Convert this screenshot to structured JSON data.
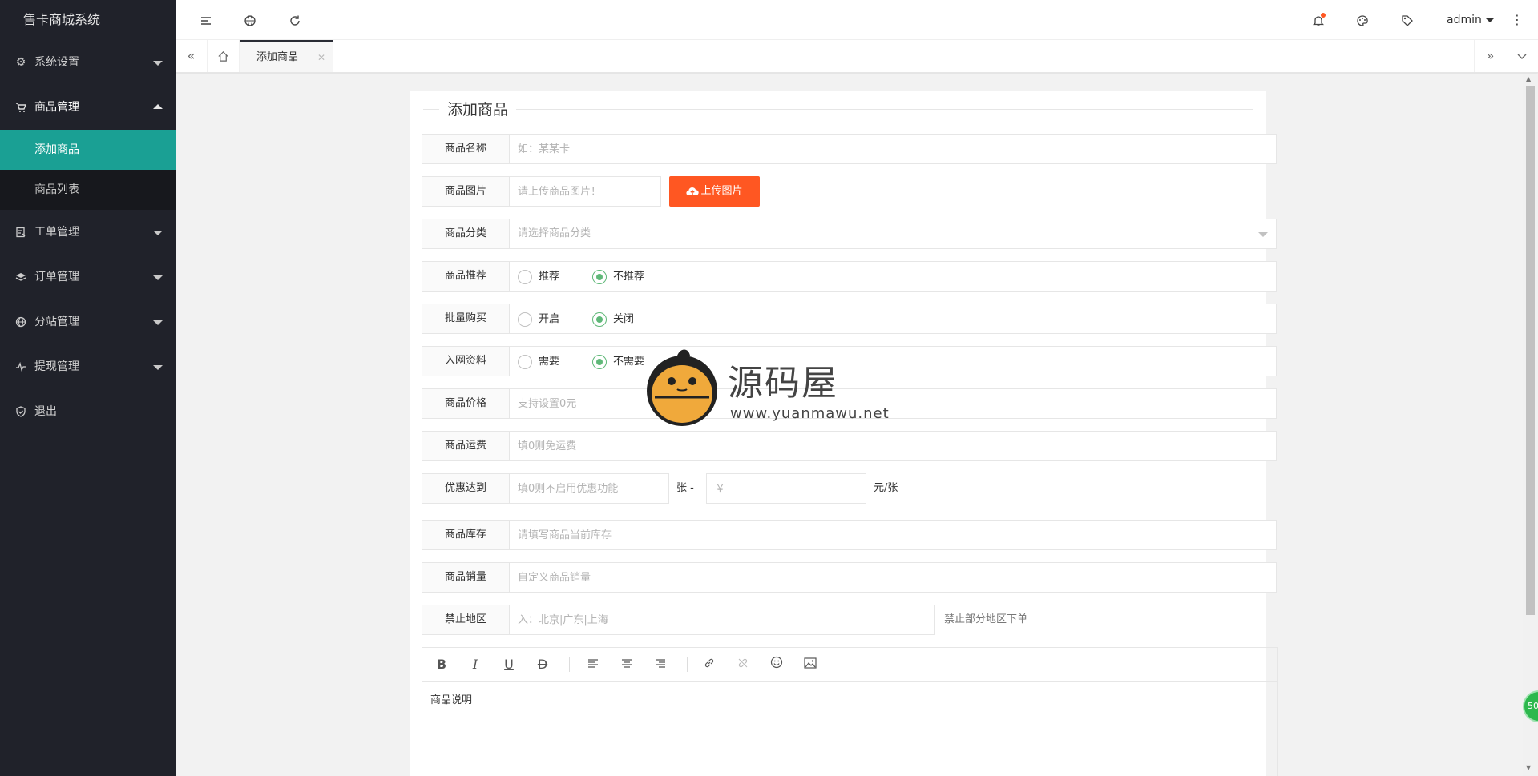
{
  "app": {
    "title": "售卡商城系统"
  },
  "sidebar": {
    "items": [
      {
        "label": "系统设置",
        "icon": "gear-icon",
        "open": false
      },
      {
        "label": "商品管理",
        "icon": "cart-icon",
        "open": true,
        "children": [
          {
            "label": "添加商品",
            "active": true
          },
          {
            "label": "商品列表",
            "active": false
          }
        ]
      },
      {
        "label": "工单管理",
        "icon": "ticket-icon",
        "open": false
      },
      {
        "label": "订单管理",
        "icon": "layers-icon",
        "open": false
      },
      {
        "label": "分站管理",
        "icon": "globe-icon",
        "open": false
      },
      {
        "label": "提现管理",
        "icon": "pulse-icon",
        "open": false
      },
      {
        "label": "退出",
        "icon": "shield-icon",
        "open": false
      }
    ]
  },
  "header": {
    "user": "admin"
  },
  "tabs": {
    "current": "添加商品"
  },
  "form": {
    "legend": "添加商品",
    "name": {
      "label": "商品名称",
      "placeholder": "如：某某卡"
    },
    "image": {
      "label": "商品图片",
      "placeholder": "请上传商品图片！",
      "button": "上传图片"
    },
    "category": {
      "label": "商品分类",
      "placeholder": "请选择商品分类"
    },
    "recommend": {
      "label": "商品推荐",
      "options": [
        "推荐",
        "不推荐"
      ],
      "selected": 1
    },
    "bulk": {
      "label": "批量购买",
      "options": [
        "开启",
        "关闭"
      ],
      "selected": 1
    },
    "network": {
      "label": "入网资料",
      "options": [
        "需要",
        "不需要"
      ],
      "selected": 1
    },
    "price": {
      "label": "商品价格",
      "placeholder": "支持设置0元"
    },
    "shipping": {
      "label": "商品运费",
      "placeholder": "填0则免运费"
    },
    "discount": {
      "label": "优惠达到",
      "placeholder": "填0则不启用优惠功能",
      "mid": "张 -",
      "price_placeholder": "￥",
      "unit": "元/张"
    },
    "stock": {
      "label": "商品库存",
      "placeholder": "请填写商品当前库存"
    },
    "sales": {
      "label": "商品销量",
      "placeholder": "自定义商品销量"
    },
    "region": {
      "label": "禁止地区",
      "placeholder": "入：北京|广东|上海",
      "hint": "禁止部分地区下单"
    },
    "editor": {
      "content": "商品说明"
    }
  },
  "watermark": {
    "title": "源码屋",
    "url": "www.yuanmawu.net"
  },
  "float_badge": "50"
}
